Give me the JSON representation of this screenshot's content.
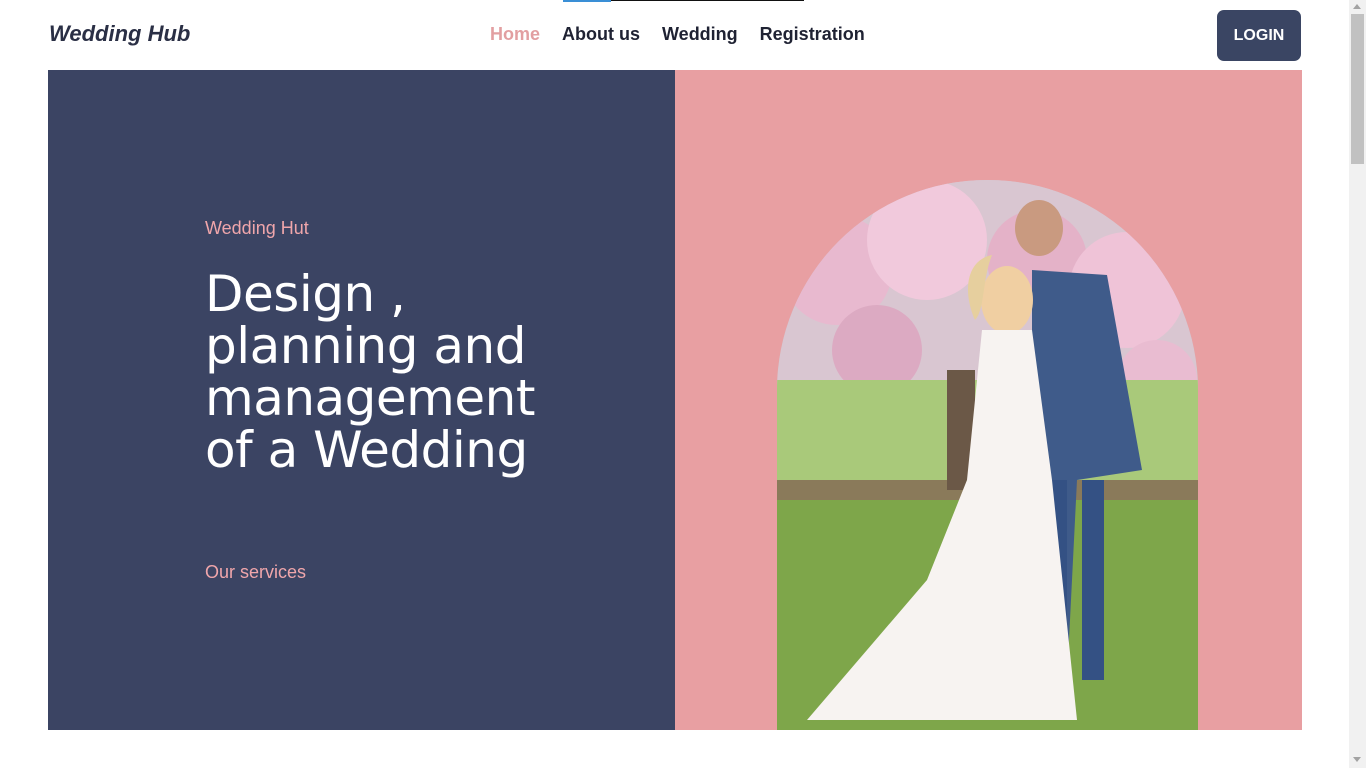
{
  "header": {
    "logo": "Wedding Hub",
    "nav": [
      {
        "label": "Home",
        "active": true
      },
      {
        "label": "About us",
        "active": false
      },
      {
        "label": "Wedding",
        "active": false
      },
      {
        "label": "Registration",
        "active": false
      }
    ],
    "login_label": "LOGIN"
  },
  "hero": {
    "eyebrow": "Wedding Hut",
    "headline": "Design , planning and management of a Wedding",
    "services_link": "Our services",
    "photo_icon": "bride-and-groom-photo"
  },
  "colors": {
    "navy": "#3b4463",
    "pink": "#e89fa2",
    "accent_text": "#f0a6ab",
    "nav_active": "#e29fa1"
  }
}
